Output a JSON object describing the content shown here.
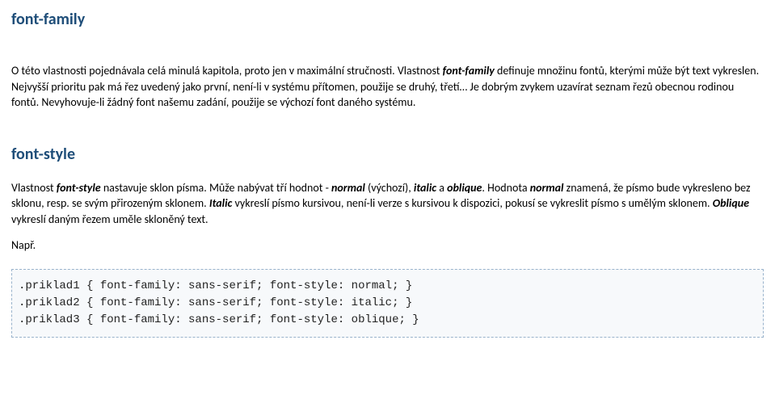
{
  "sections": {
    "fontFamily": {
      "title": "font-family",
      "p1_a": "O této vlastnosti pojednávala celá minulá kapitola, proto jen v maximální stručnosti. Vlastnost ",
      "p1_b": "font-family",
      "p1_c": " definuje množinu fontů, kterými může být text vykreslen. Nejvyšší prioritu pak má řez uvedený jako první, není-li v systému přítomen, použije se druhý, třetí… Je dobrým zvykem uzavírat seznam řezů obecnou rodinou fontů. Nevyhovuje-li žádný font našemu zadání, použije se výchozí font daného systému."
    },
    "fontStyle": {
      "title": "font-style",
      "p1_a": "Vlastnost ",
      "p1_b": "font-style",
      "p1_c": " nastavuje sklon písma. Může nabývat tří hodnot - ",
      "p1_d": "normal",
      "p1_e": " (výchozí), ",
      "p1_f": "italic",
      "p1_g": " a ",
      "p1_h": "oblique",
      "p1_i": ". Hodnota ",
      "p1_j": "normal",
      "p1_k": " znamená, že písmo bude vykresleno bez sklonu, resp. se svým přirozeným sklonem. ",
      "p1_l": "Italic",
      "p1_m": " vykreslí písmo kursivou, není-li verze s kursivou k dispozici, pokusí se vykreslit písmo s umělým sklonem. ",
      "p1_n": "Oblique",
      "p1_o": " vykreslí daným řezem uměle skloněný text.",
      "example_label": "Např.",
      "code": ".priklad1 { font-family: sans-serif; font-style: normal; }\n.priklad2 { font-family: sans-serif; font-style: italic; }\n.priklad3 { font-family: sans-serif; font-style: oblique; }"
    }
  }
}
